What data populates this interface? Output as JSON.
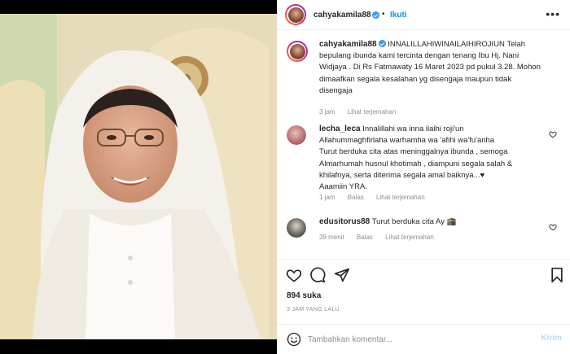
{
  "post": {
    "username": "cahyakamila88",
    "follow_label": "Ikuti",
    "more_label": "•••"
  },
  "caption": {
    "username": "cahyakamila88",
    "line1": "INNALILLAHIWINAILAIHIROJIUN Telah",
    "line2": "bepulang ibunda kami tercinta dengan tenang Ibu Hj. Nani",
    "line3": "Widjaya . Di Rs Fatmawaty 16 Maret 2023 pd pukul 3.28. Mohon",
    "line4": "dimaafkan segala kesalahan yg disengaja maupun tidak",
    "line5": "disengaja",
    "time": "3 jam",
    "translate": "Lihat terjemahan"
  },
  "comments": [
    {
      "username": "lecha_leca",
      "lines": [
        "Innalillahi wa inna ilaihi roji'un",
        "Allahummaghfirlaha warhamha wa 'afihi wa'fu'anha",
        "Turut berduka cita atas meninggalnya ibunda , semoga",
        "Almarhumah husnul khotimah , diampuni segala salah &",
        "khilafnya, serta diterima segala amal baiknya...♥",
        "Aaamiin YRA."
      ],
      "time": "1 jam",
      "reply": "Balas",
      "translate": "Lihat terjemahan"
    },
    {
      "username": "edusitorus88",
      "text": "Turut berduka cita Ay 🕋",
      "time": "39 menit",
      "reply": "Balas",
      "translate": "Lihat terjemahan"
    }
  ],
  "actions": {
    "icons": [
      "heart-icon",
      "comment-icon",
      "share-icon",
      "bookmark-icon"
    ],
    "likes": "894 suka",
    "timestamp": "3 JAM YANG LALU"
  },
  "add_comment": {
    "placeholder": "Tambahkan komentar...",
    "post_label": "Kirim"
  },
  "colors": {
    "link": "#0095f6",
    "muted": "#8e8e8e",
    "text": "#262626",
    "post_disabled": "#b3dbff"
  }
}
